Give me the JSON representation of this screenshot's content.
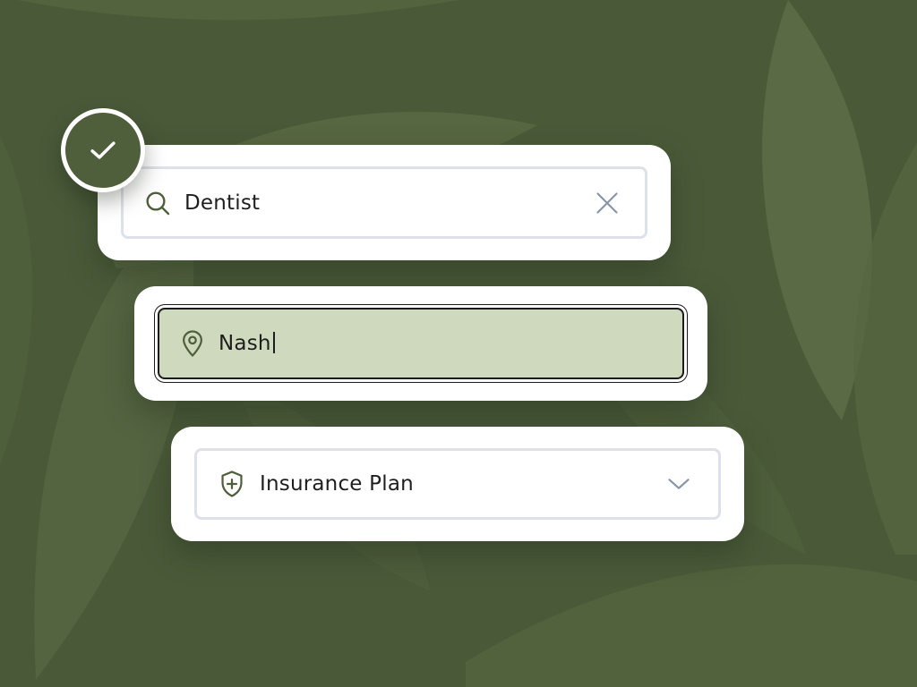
{
  "colors": {
    "background": "#4a5a39",
    "accent_green": "#4f5f3b",
    "active_field_fill": "#cfd9bd",
    "card": "#ffffff",
    "field_border": "#dde2ea",
    "icon_gray": "#8a96a8"
  },
  "status": {
    "icon": "check-icon",
    "state": "complete"
  },
  "search": {
    "value": "Dentist",
    "icon": "search-icon",
    "clear_icon": "close-icon"
  },
  "location": {
    "value": "Nash",
    "icon": "map-pin-icon",
    "focused": true
  },
  "insurance": {
    "value": "Insurance Plan",
    "icon": "shield-plus-icon",
    "dropdown_icon": "chevron-down-icon"
  }
}
